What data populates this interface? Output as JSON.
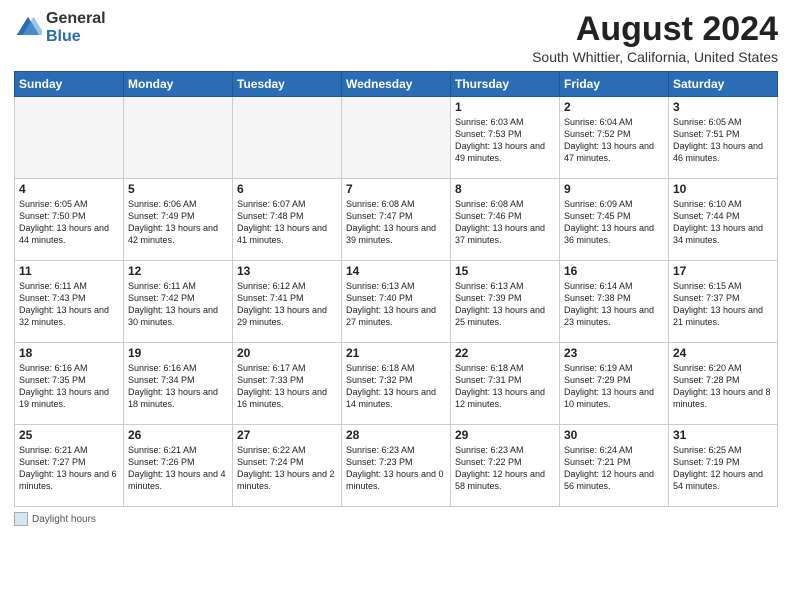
{
  "logo": {
    "general": "General",
    "blue": "Blue"
  },
  "title": "August 2024",
  "subtitle": "South Whittier, California, United States",
  "days_of_week": [
    "Sunday",
    "Monday",
    "Tuesday",
    "Wednesday",
    "Thursday",
    "Friday",
    "Saturday"
  ],
  "footer": {
    "daylight_label": "Daylight hours"
  },
  "weeks": [
    [
      {
        "day": "",
        "empty": true
      },
      {
        "day": "",
        "empty": true
      },
      {
        "day": "",
        "empty": true
      },
      {
        "day": "",
        "empty": true
      },
      {
        "day": "1",
        "sunrise": "6:03 AM",
        "sunset": "7:53 PM",
        "daylight": "13 hours and 49 minutes."
      },
      {
        "day": "2",
        "sunrise": "6:04 AM",
        "sunset": "7:52 PM",
        "daylight": "13 hours and 47 minutes."
      },
      {
        "day": "3",
        "sunrise": "6:05 AM",
        "sunset": "7:51 PM",
        "daylight": "13 hours and 46 minutes."
      }
    ],
    [
      {
        "day": "4",
        "sunrise": "6:05 AM",
        "sunset": "7:50 PM",
        "daylight": "13 hours and 44 minutes."
      },
      {
        "day": "5",
        "sunrise": "6:06 AM",
        "sunset": "7:49 PM",
        "daylight": "13 hours and 42 minutes."
      },
      {
        "day": "6",
        "sunrise": "6:07 AM",
        "sunset": "7:48 PM",
        "daylight": "13 hours and 41 minutes."
      },
      {
        "day": "7",
        "sunrise": "6:08 AM",
        "sunset": "7:47 PM",
        "daylight": "13 hours and 39 minutes."
      },
      {
        "day": "8",
        "sunrise": "6:08 AM",
        "sunset": "7:46 PM",
        "daylight": "13 hours and 37 minutes."
      },
      {
        "day": "9",
        "sunrise": "6:09 AM",
        "sunset": "7:45 PM",
        "daylight": "13 hours and 36 minutes."
      },
      {
        "day": "10",
        "sunrise": "6:10 AM",
        "sunset": "7:44 PM",
        "daylight": "13 hours and 34 minutes."
      }
    ],
    [
      {
        "day": "11",
        "sunrise": "6:11 AM",
        "sunset": "7:43 PM",
        "daylight": "13 hours and 32 minutes."
      },
      {
        "day": "12",
        "sunrise": "6:11 AM",
        "sunset": "7:42 PM",
        "daylight": "13 hours and 30 minutes."
      },
      {
        "day": "13",
        "sunrise": "6:12 AM",
        "sunset": "7:41 PM",
        "daylight": "13 hours and 29 minutes."
      },
      {
        "day": "14",
        "sunrise": "6:13 AM",
        "sunset": "7:40 PM",
        "daylight": "13 hours and 27 minutes."
      },
      {
        "day": "15",
        "sunrise": "6:13 AM",
        "sunset": "7:39 PM",
        "daylight": "13 hours and 25 minutes."
      },
      {
        "day": "16",
        "sunrise": "6:14 AM",
        "sunset": "7:38 PM",
        "daylight": "13 hours and 23 minutes."
      },
      {
        "day": "17",
        "sunrise": "6:15 AM",
        "sunset": "7:37 PM",
        "daylight": "13 hours and 21 minutes."
      }
    ],
    [
      {
        "day": "18",
        "sunrise": "6:16 AM",
        "sunset": "7:35 PM",
        "daylight": "13 hours and 19 minutes."
      },
      {
        "day": "19",
        "sunrise": "6:16 AM",
        "sunset": "7:34 PM",
        "daylight": "13 hours and 18 minutes."
      },
      {
        "day": "20",
        "sunrise": "6:17 AM",
        "sunset": "7:33 PM",
        "daylight": "13 hours and 16 minutes."
      },
      {
        "day": "21",
        "sunrise": "6:18 AM",
        "sunset": "7:32 PM",
        "daylight": "13 hours and 14 minutes."
      },
      {
        "day": "22",
        "sunrise": "6:18 AM",
        "sunset": "7:31 PM",
        "daylight": "13 hours and 12 minutes."
      },
      {
        "day": "23",
        "sunrise": "6:19 AM",
        "sunset": "7:29 PM",
        "daylight": "13 hours and 10 minutes."
      },
      {
        "day": "24",
        "sunrise": "6:20 AM",
        "sunset": "7:28 PM",
        "daylight": "13 hours and 8 minutes."
      }
    ],
    [
      {
        "day": "25",
        "sunrise": "6:21 AM",
        "sunset": "7:27 PM",
        "daylight": "13 hours and 6 minutes."
      },
      {
        "day": "26",
        "sunrise": "6:21 AM",
        "sunset": "7:26 PM",
        "daylight": "13 hours and 4 minutes."
      },
      {
        "day": "27",
        "sunrise": "6:22 AM",
        "sunset": "7:24 PM",
        "daylight": "13 hours and 2 minutes."
      },
      {
        "day": "28",
        "sunrise": "6:23 AM",
        "sunset": "7:23 PM",
        "daylight": "13 hours and 0 minutes."
      },
      {
        "day": "29",
        "sunrise": "6:23 AM",
        "sunset": "7:22 PM",
        "daylight": "12 hours and 58 minutes."
      },
      {
        "day": "30",
        "sunrise": "6:24 AM",
        "sunset": "7:21 PM",
        "daylight": "12 hours and 56 minutes."
      },
      {
        "day": "31",
        "sunrise": "6:25 AM",
        "sunset": "7:19 PM",
        "daylight": "12 hours and 54 minutes."
      }
    ]
  ]
}
